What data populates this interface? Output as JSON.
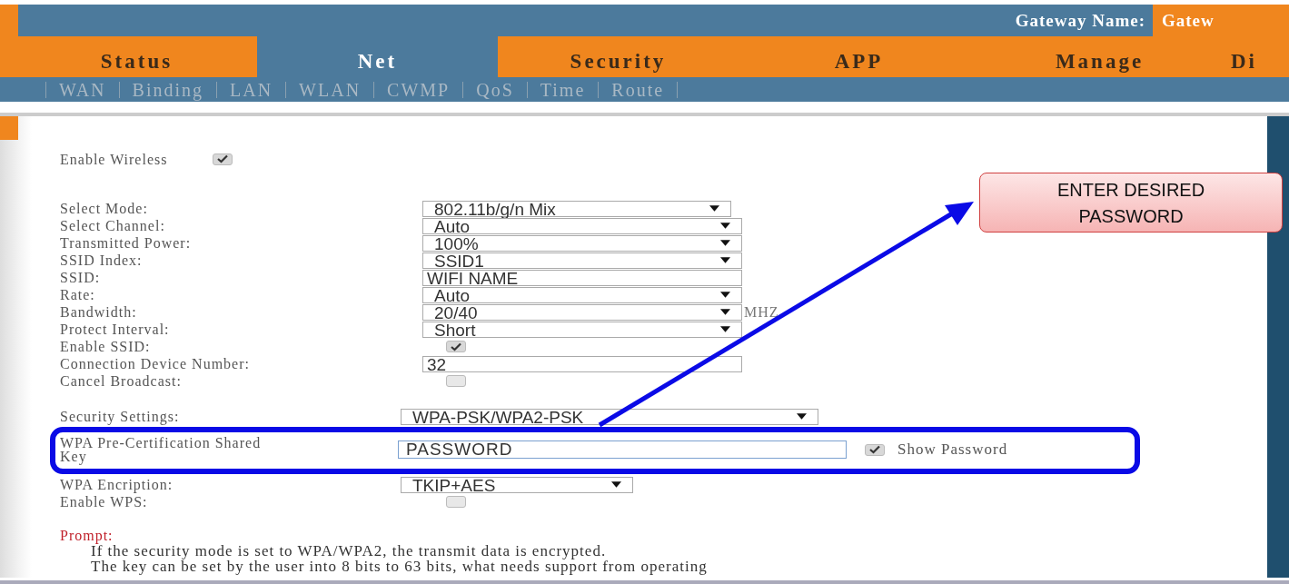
{
  "header": {
    "gateway_label": "Gateway Name:",
    "gateway_value": "Gatew"
  },
  "tabs": [
    {
      "label": "Status",
      "selected": false
    },
    {
      "label": "Net",
      "selected": true
    },
    {
      "label": "Security",
      "selected": false
    },
    {
      "label": "APP",
      "selected": false
    },
    {
      "label": "Manage",
      "selected": false
    },
    {
      "label": "Di",
      "selected": false
    }
  ],
  "subtabs": [
    {
      "label": "WAN",
      "selected": false
    },
    {
      "label": "Binding",
      "selected": false
    },
    {
      "label": "LAN",
      "selected": false
    },
    {
      "label": "WLAN",
      "selected": false
    },
    {
      "label": "CWMP",
      "selected": false
    },
    {
      "label": "QoS",
      "selected": false
    },
    {
      "label": "Time",
      "selected": false
    },
    {
      "label": "Route",
      "selected": false
    }
  ],
  "enable_wireless": {
    "label": "Enable Wireless",
    "checked": true
  },
  "rows": [
    {
      "kind": "select",
      "label": "Select Mode:",
      "value": "802.11b/g/n Mix"
    },
    {
      "kind": "select",
      "label": "Select Channel:",
      "value": "Auto"
    },
    {
      "kind": "select",
      "label": "Transmitted Power:",
      "value": "100%"
    },
    {
      "kind": "select",
      "label": "SSID Index:",
      "value": "SSID1"
    },
    {
      "kind": "text",
      "label": "SSID:",
      "value": "WIFI NAME"
    },
    {
      "kind": "select",
      "label": "Rate:",
      "value": "Auto"
    },
    {
      "kind": "select",
      "label": "Bandwidth:",
      "value": "20/40",
      "suffix": "MHZ"
    },
    {
      "kind": "select",
      "label": "Protect Interval:",
      "value": "Short"
    },
    {
      "kind": "checkbox",
      "label": "Enable SSID:",
      "checked": true
    },
    {
      "kind": "text",
      "label": "Connection Device Number:",
      "value": "32"
    },
    {
      "kind": "checkbox",
      "label": "Cancel Broadcast:",
      "checked": false
    }
  ],
  "security": {
    "label": "Security Settings:",
    "value": "WPA-PSK/WPA2-PSK"
  },
  "key": {
    "label": "WPA Pre-Certification Shared Key",
    "value": "PASSWORD",
    "show_label": "Show Password",
    "show_checked": true
  },
  "encryption": {
    "label": "WPA Encription:",
    "value": "TKIP+AES"
  },
  "wps": {
    "label": "Enable WPS:",
    "checked": false
  },
  "prompt": {
    "title": "Prompt:",
    "lines": [
      "If the security mode is set to WPA/WPA2, the transmit data is encrypted.",
      "The key can be set by the user into 8 bits to 63 bits, what needs support from operating"
    ]
  },
  "callout": {
    "text": "ENTER DESIRED PASSWORD"
  }
}
